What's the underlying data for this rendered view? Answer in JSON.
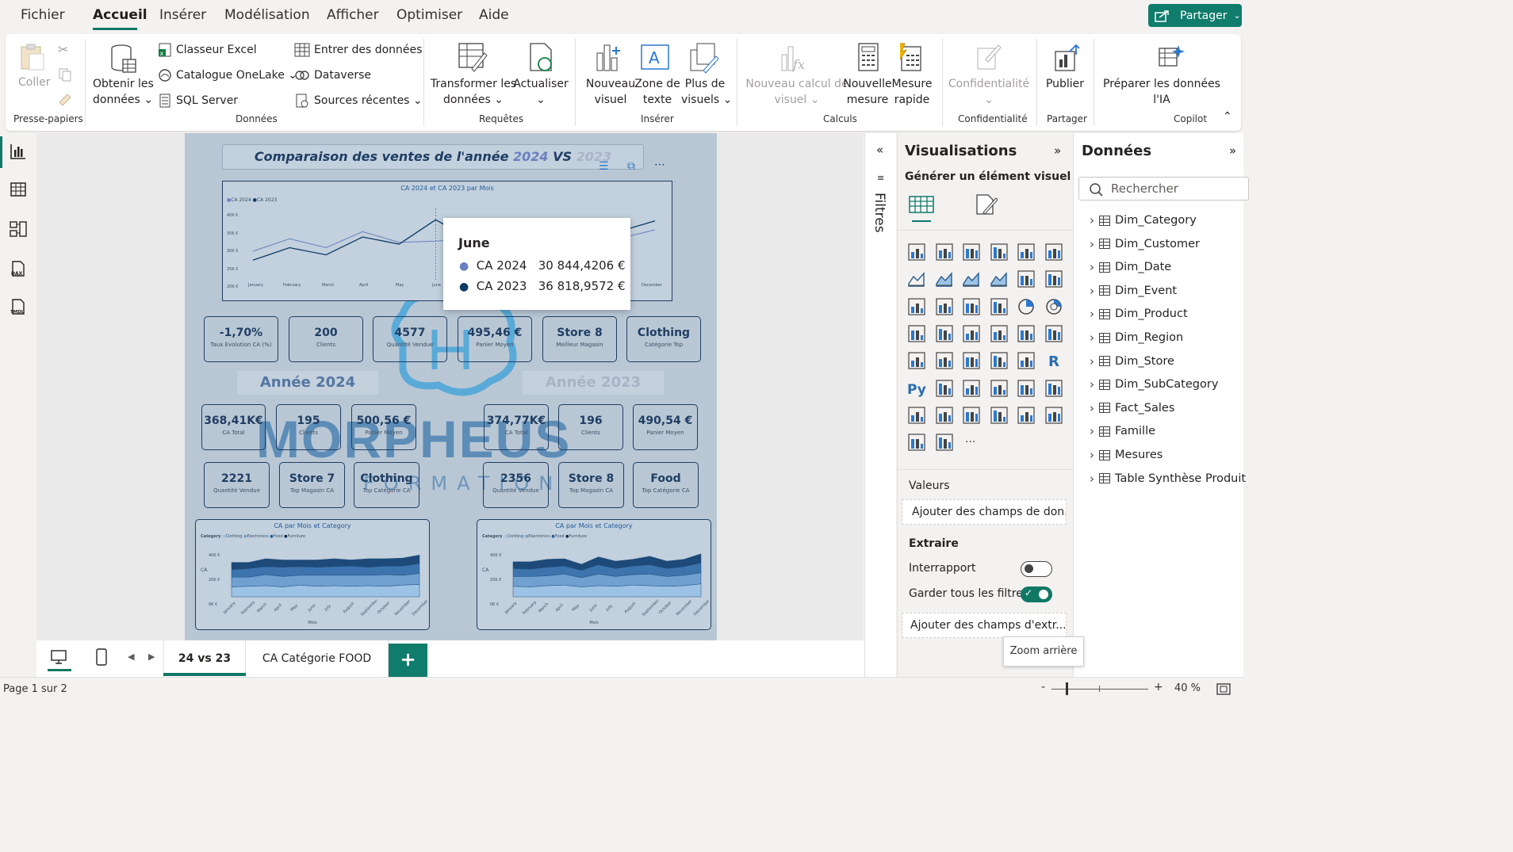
{
  "menu": {
    "items": [
      "Fichier",
      "Accueil",
      "Insérer",
      "Modélisation",
      "Afficher",
      "Optimiser",
      "Aide"
    ],
    "active": "Accueil",
    "share": "Partager"
  },
  "ribbon": {
    "paste": "Coller",
    "clipboard_group": "Presse-papiers",
    "get_data_1": "Obtenir les",
    "get_data_2": "données",
    "excel": "Classeur Excel",
    "onelake": "Catalogue OneLake",
    "sql": "SQL Server",
    "enter_data": "Entrer des données",
    "dataverse": "Dataverse",
    "recent": "Sources récentes",
    "data_group": "Données",
    "transform_1": "Transformer les",
    "transform_2": "données",
    "refresh": "Actualiser",
    "queries_group": "Requêtes",
    "new_visual_1": "Nouveau",
    "new_visual_2": "visuel",
    "textbox_1": "Zone de",
    "textbox_2": "texte",
    "more_visuals_1": "Plus de",
    "more_visuals_2": "visuels",
    "insert_group": "Insérer",
    "new_calc_1": "Nouveau calcul de",
    "new_calc_2": "visuel",
    "new_measure_1": "Nouvelle",
    "new_measure_2": "mesure",
    "quick_measure_1": "Mesure",
    "quick_measure_2": "rapide",
    "calc_group": "Calculs",
    "sensitivity": "Confidentialité",
    "sensitivity_group": "Confidentialité",
    "publish": "Publier",
    "share_group": "Partager",
    "copilot_1": "Préparer les données",
    "copilot_2": "l'IA",
    "copilot_group": "Copilot"
  },
  "report": {
    "title_prefix": "Comparaison des ventes de l'année ",
    "year_a": "2024",
    "vs": " VS ",
    "year_b": "2023",
    "line_chart_title": "CA 2024 et CA 2023 par Mois",
    "legend": [
      "CA 2024",
      "CA 2023"
    ],
    "months_visible": [
      "January",
      "February",
      "March",
      "April",
      "May",
      "June",
      "December"
    ],
    "yticks": [
      "40K €",
      "35K €",
      "30K €",
      "25K €",
      "20K €"
    ],
    "kpi_top": [
      {
        "value": "-1,70%",
        "label": "Taux Evolution CA (%)"
      },
      {
        "value": "200",
        "label": "Clients"
      },
      {
        "value": "4577",
        "label": "Quantité Vendue"
      },
      {
        "value": "495,46 €",
        "label": "Panier Moyen"
      },
      {
        "value": "Store 8",
        "label": "Meilleur Magasin"
      },
      {
        "value": "Clothing",
        "label": "Catégorie Top"
      }
    ],
    "year_2024_label": "Année 2024",
    "year_2023_label": "Année 2023",
    "kpi_2024_row1": [
      {
        "value": "368,41K€",
        "label": "CA Total"
      },
      {
        "value": "195",
        "label": "Clients"
      },
      {
        "value": "500,56 €",
        "label": "Panier Moyen"
      }
    ],
    "kpi_2024_row2": [
      {
        "value": "2221",
        "label": "Quantité Vendue"
      },
      {
        "value": "Store 7",
        "label": "Top Magasin CA"
      },
      {
        "value": "Clothing",
        "label": "Top Catégorie CA"
      }
    ],
    "kpi_2023_row1": [
      {
        "value": "374,77K€",
        "label": "CA Total"
      },
      {
        "value": "196",
        "label": "Clients"
      },
      {
        "value": "490,54 €",
        "label": "Panier Moyen"
      }
    ],
    "kpi_2023_row2": [
      {
        "value": "2356",
        "label": "Quantité Vendue"
      },
      {
        "value": "Store 8",
        "label": "Top Magasin CA"
      },
      {
        "value": "Food",
        "label": "Top Catégorie CA"
      }
    ],
    "area_title": "CA par Mois et Category",
    "area_legend_label": "Category",
    "area_legend": [
      "Clothing",
      "Electronics",
      "Food",
      "Furniture"
    ],
    "area_yticks": [
      "40K €",
      "20K €",
      "0K €"
    ],
    "area_ylabel": "CA",
    "area_xlabel": "Mois",
    "area_months": [
      "January",
      "February",
      "March",
      "April",
      "May",
      "June",
      "July",
      "August",
      "September",
      "October",
      "November",
      "December"
    ],
    "watermark_1": "MORPHEUS",
    "watermark_2": "FORMATION"
  },
  "tooltip": {
    "title": "June",
    "rows": [
      {
        "name": "CA 2024",
        "value": "30 844,4206 €",
        "color": "#6b7fbf"
      },
      {
        "name": "CA 2023",
        "value": "36 818,9572 €",
        "color": "#0d3a66"
      }
    ]
  },
  "pages": {
    "tabs": [
      "24 vs 23",
      "CA Catégorie FOOD"
    ],
    "active": "24 vs 23",
    "add": "+"
  },
  "status": {
    "page": "Page 1 sur 2",
    "zoom": "40 %",
    "zoom_tooltip": "Zoom arrière",
    "minus": "-",
    "plus": "+"
  },
  "filters": {
    "label": "Filtres"
  },
  "viz": {
    "title": "Visualisations",
    "generate": "Générer un élément visuel",
    "values": "Valeurs",
    "values_placeholder": "Ajouter des champs de don...",
    "drillthrough": "Extraire",
    "cross_report": "Interrapport",
    "keep_filters": "Garder tous les filtres",
    "drill_placeholder": "Ajouter des champs d'extr...",
    "more": "···"
  },
  "data_pane": {
    "title": "Données",
    "search_placeholder": "Rechercher",
    "tables": [
      "Dim_Category",
      "Dim_Customer",
      "Dim_Date",
      "Dim_Event",
      "Dim_Product",
      "Dim_Region",
      "Dim_Store",
      "Dim_SubCategory",
      "Fact_Sales",
      "Famille",
      "Mesures",
      "Table Synthèse Produit"
    ]
  },
  "chart_data": [
    {
      "type": "line",
      "title": "CA 2024 et CA 2023 par Mois",
      "ylim": [
        20000,
        40000
      ],
      "categories": [
        "January",
        "February",
        "March",
        "April",
        "May",
        "June",
        "July",
        "August",
        "September",
        "October",
        "November",
        "December"
      ],
      "series": [
        {
          "name": "CA 2024",
          "values": [
            28000,
            31500,
            29000,
            33500,
            30500,
            30844,
            31500,
            32000,
            33000,
            33500,
            31500,
            34000
          ]
        },
        {
          "name": "CA 2023",
          "values": [
            25500,
            29000,
            27000,
            32000,
            30000,
            36819,
            31000,
            30000,
            33000,
            31000,
            33500,
            36500
          ]
        }
      ]
    },
    {
      "type": "area",
      "title": "CA par Mois et Category",
      "ylim": [
        0,
        40000
      ],
      "categories": [
        "January",
        "February",
        "March",
        "April",
        "May",
        "June",
        "July",
        "August",
        "September",
        "October",
        "November",
        "December"
      ],
      "series": [
        {
          "name": "Clothing",
          "values": [
            8000,
            8500,
            9000,
            8000,
            9500,
            8500,
            9000,
            8500,
            9000,
            8500,
            9500,
            10000
          ]
        },
        {
          "name": "Electronics",
          "values": [
            8000,
            7500,
            9000,
            8500,
            8000,
            9000,
            8500,
            9000,
            8500,
            9500,
            8000,
            9000
          ]
        },
        {
          "name": "Food",
          "values": [
            6000,
            7000,
            6500,
            7500,
            7000,
            6500,
            7000,
            7500,
            6500,
            7000,
            7500,
            8000
          ]
        },
        {
          "name": "Furniture",
          "values": [
            6000,
            5000,
            6500,
            6000,
            5500,
            6000,
            6500,
            5000,
            7000,
            6000,
            6500,
            7000
          ]
        }
      ]
    },
    {
      "type": "area",
      "title": "CA par Mois et Category",
      "ylim": [
        0,
        40000
      ],
      "categories": [
        "January",
        "February",
        "March",
        "April",
        "May",
        "June",
        "July",
        "August",
        "September",
        "October",
        "November",
        "December"
      ],
      "series": [
        {
          "name": "Clothing",
          "values": [
            8500,
            8000,
            9000,
            9500,
            8000,
            9000,
            8500,
            9500,
            9000,
            8500,
            9000,
            10500
          ]
        },
        {
          "name": "Electronics",
          "values": [
            8000,
            8500,
            8000,
            9000,
            7500,
            9500,
            8000,
            8500,
            9500,
            8000,
            8500,
            9000
          ]
        },
        {
          "name": "Food",
          "values": [
            6500,
            6000,
            7000,
            6500,
            6000,
            7500,
            6500,
            7000,
            7500,
            6500,
            7000,
            8000
          ]
        },
        {
          "name": "Furniture",
          "values": [
            5500,
            6000,
            6500,
            6000,
            5000,
            6500,
            6000,
            5500,
            7000,
            6000,
            6000,
            7500
          ]
        }
      ]
    }
  ]
}
